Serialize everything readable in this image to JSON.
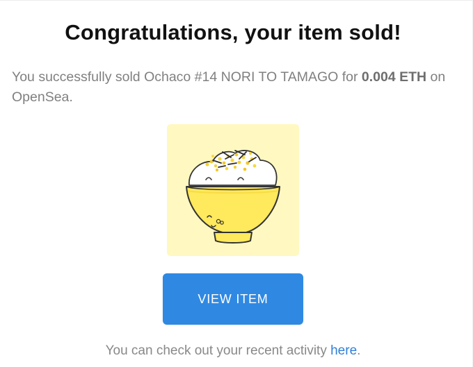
{
  "email": {
    "headline": "Congratulations, your item sold!",
    "message": {
      "prefix": "You successfully sold ",
      "item_name": "Ochaco #14 NORI TO TAMAGO",
      "middle": " for ",
      "price": "0.004 ETH",
      "suffix": " on OpenSea."
    },
    "nft_image": {
      "icon": "rice-bowl-illustration",
      "background_color": "#fff8c1",
      "bowl_color": "#ffe95c"
    },
    "view_button_label": "VIEW ITEM",
    "footer": {
      "prefix": "You can check out your recent activity ",
      "link_text": "here",
      "suffix": "."
    }
  },
  "colors": {
    "button": "#2f89e3",
    "link": "#2f7fd8",
    "body_text": "#808080",
    "headline": "#111111"
  }
}
